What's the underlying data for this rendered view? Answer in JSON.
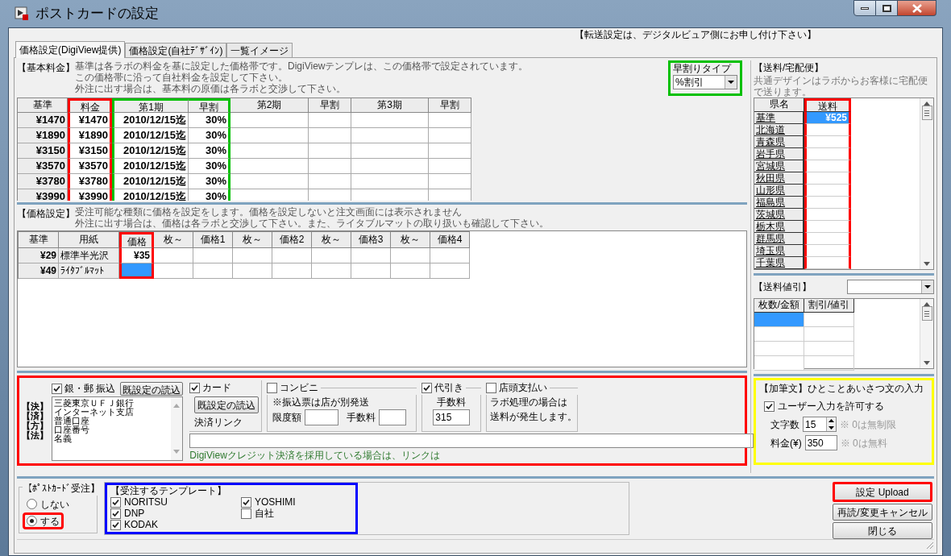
{
  "window": {
    "title": "ポストカードの設定"
  },
  "notice": "【転送設定は、デジタルビュア側にお申し付け下さい】",
  "tabs": [
    {
      "label": "価格設定(DigiView提供)",
      "selected": true
    },
    {
      "label": "価格設定(自社ﾃﾞｻﾞｲﾝ)",
      "selected": false
    },
    {
      "label": "一覧イメージ",
      "selected": false
    }
  ],
  "basic_fee": {
    "label": "【基本料金】",
    "description": [
      "基準は各ラボの料金を基に設定した価格帯です。DigiViewテンプレは、この価格帯で設定されています。",
      "この価格帯に沿って自社料金を設定して下さい。",
      "外注に出す場合は、基本料の原価は各ラボと交渉して下さい。"
    ],
    "early_type": {
      "label": "早割りタイプ",
      "value": "%割引",
      "color": "#00c000"
    },
    "table": {
      "columns": [
        {
          "label": "基準"
        },
        {
          "label": "料金",
          "color": "#ff0000"
        },
        {
          "label": "第1期",
          "color": "#00c000"
        },
        {
          "label": "早割",
          "color": "#00c000"
        },
        {
          "label": "第2期"
        },
        {
          "label": "早割"
        },
        {
          "label": "第3期"
        },
        {
          "label": "早割"
        }
      ],
      "rows": [
        [
          "¥1470",
          "¥1470",
          "2010/12/15迄",
          "30%"
        ],
        [
          "¥1890",
          "¥1890",
          "2010/12/15迄",
          "30%"
        ],
        [
          "¥3150",
          "¥3150",
          "2010/12/15迄",
          "30%"
        ],
        [
          "¥3570",
          "¥3570",
          "2010/12/15迄",
          "30%"
        ],
        [
          "¥3780",
          "¥3780",
          "2010/12/15迄",
          "30%"
        ],
        [
          "¥3990",
          "¥3990",
          "2010/12/15迄",
          "30%"
        ]
      ]
    }
  },
  "price_setting": {
    "label": "【価格設定】",
    "description": [
      "受注可能な種類に価格を設定をします。価格を設定しないと注文画面には表示されません",
      "外注に出す場合は、価格は各ラボと交渉して下さい。また、ライタブルマットの取り扱いも確認して下さい。"
    ],
    "table": {
      "columns": [
        {
          "label": "基準"
        },
        {
          "label": "用紙"
        },
        {
          "label": "価格",
          "color": "#ff0000"
        },
        {
          "label": "枚～"
        },
        {
          "label": "価格1"
        },
        {
          "label": "枚～"
        },
        {
          "label": "価格2"
        },
        {
          "label": "枚～"
        },
        {
          "label": "価格3"
        },
        {
          "label": "枚～"
        },
        {
          "label": "価格4"
        }
      ],
      "rows": [
        [
          {
            "text": "¥29",
            "selected": false
          },
          {
            "text": "標準半光沢",
            "selected": false
          },
          {
            "text": "¥35",
            "selected": false
          }
        ],
        [
          {
            "text": "¥49",
            "selected": false
          },
          {
            "text": "ﾗｲﾀﾌﾞﾙﾏｯﾄ",
            "selected": false
          },
          {
            "selected": true
          }
        ]
      ]
    }
  },
  "shipping": {
    "label": "【送料/宅配便】",
    "description": [
      "共通デザインはラボからお客様に宅配便",
      "で送ります。"
    ],
    "columns": [
      {
        "label": "県名"
      },
      {
        "label": "送料",
        "color": "#ff0000"
      }
    ],
    "rows": [
      {
        "name": "基準",
        "fee": "¥525",
        "selected": true
      },
      {
        "name": "北海道",
        "selected": false
      },
      {
        "name": "青森県",
        "selected": false
      },
      {
        "name": "岩手県",
        "selected": false
      },
      {
        "name": "宮城県",
        "selected": false
      },
      {
        "name": "秋田県",
        "selected": false
      },
      {
        "name": "山形県",
        "selected": false
      },
      {
        "name": "福島県",
        "selected": false
      },
      {
        "name": "茨城県",
        "selected": false
      },
      {
        "name": "栃木県",
        "selected": false
      },
      {
        "name": "群馬県",
        "selected": false
      },
      {
        "name": "埼玉県",
        "selected": false
      },
      {
        "name": "千葉県",
        "selected": false
      }
    ]
  },
  "shipping_discount": {
    "label": "【送料値引】",
    "columns": [
      "枚数/金額",
      "割引/値引"
    ],
    "rows": [
      {
        "selected": true
      },
      {
        "selected": false
      },
      {
        "selected": false
      },
      {
        "selected": false
      }
    ]
  },
  "payment": {
    "color": "#ff0000",
    "side_label": [
      "【決】",
      "【済】",
      "【方】",
      "【法】"
    ],
    "bank": {
      "label": "銀・郵 振込",
      "checked": true,
      "button": "既設定の読込",
      "lines": [
        "三菱東京ＵＦＪ銀行",
        "インターネット支店",
        "普通口座",
        "口座番号",
        "名義"
      ]
    },
    "card": {
      "label": "カード",
      "checked": true,
      "button": "既設定の読込",
      "link_label": "決済リンク"
    },
    "convenience": {
      "label": "コンビニ",
      "checked": false,
      "note": "※振込票は店が別発送",
      "limit_label": "限度額",
      "fee_label": "手数料"
    },
    "cod": {
      "label": "代引き",
      "checked": true,
      "fee_label": "手数料",
      "fee": "315"
    },
    "store": {
      "label": "店頭支払い",
      "checked": false,
      "note": [
        "ラボ処理の場合は",
        "送料が発生します。"
      ]
    },
    "link_note": "DigiViewクレジット決済を採用している場合は、リンクは"
  },
  "add_text": {
    "label": "【加筆文】ひとことあいさつ文の入力",
    "color": "#ffff00",
    "allow": {
      "label": "ユーザー入力を許可する",
      "checked": true
    },
    "chars": {
      "label": "文字数",
      "value": "15",
      "note": "※ 0は無制限"
    },
    "fee": {
      "label": "料金(¥)",
      "value": "350",
      "note": "※ 0は無料"
    }
  },
  "postcard_order": {
    "label": "【ﾎﾟｽﾄｶｰﾄﾞ受注】",
    "options": [
      {
        "label": "しない",
        "selected": false
      },
      {
        "label": "する",
        "selected": true,
        "color": "#ff0000"
      }
    ]
  },
  "templates": {
    "label": "【受注するテンプレート】",
    "color": "#0000ff",
    "items": [
      {
        "label": "NORITSU",
        "checked": true
      },
      {
        "label": "DNP",
        "checked": true
      },
      {
        "label": "KODAK",
        "checked": true
      },
      {
        "label": "YOSHIMI",
        "checked": true
      },
      {
        "label": "自社",
        "checked": false
      }
    ]
  },
  "buttons": [
    {
      "label": "設定 Upload",
      "color": "#ff0000"
    },
    {
      "label": "再読/変更キャンセル"
    },
    {
      "label": "閉じる"
    }
  ]
}
